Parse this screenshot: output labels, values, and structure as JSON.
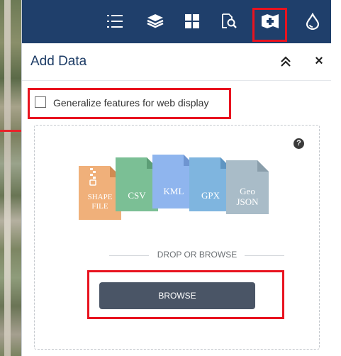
{
  "panel": {
    "title": "Add Data",
    "close_glyph": "×"
  },
  "toolbar": {
    "icons": [
      "list-icon",
      "layers-icon",
      "grid-icon",
      "search-document-icon",
      "add-data-icon",
      "droplet-icon"
    ],
    "active_icon": "add-data-icon",
    "background_color": "#1f3f6b",
    "highlight_color": "#e8131f"
  },
  "options": {
    "generalize_label": "Generalize features for web display",
    "generalize_checked": false
  },
  "dropzone": {
    "help_glyph": "?",
    "file_types": [
      {
        "label": "SHAPE FILE",
        "color": "#f0b07a",
        "icon": "zip-icon"
      },
      {
        "label": "CSV",
        "color": "#7bbf95"
      },
      {
        "label": "KML",
        "color": "#8fb5ee"
      },
      {
        "label": "GPX",
        "color": "#7fb5df"
      },
      {
        "label": "Geo JSON",
        "color": "#a9bcc8"
      }
    ],
    "separator_text": "DROP OR BROWSE",
    "browse_label": "BROWSE"
  }
}
